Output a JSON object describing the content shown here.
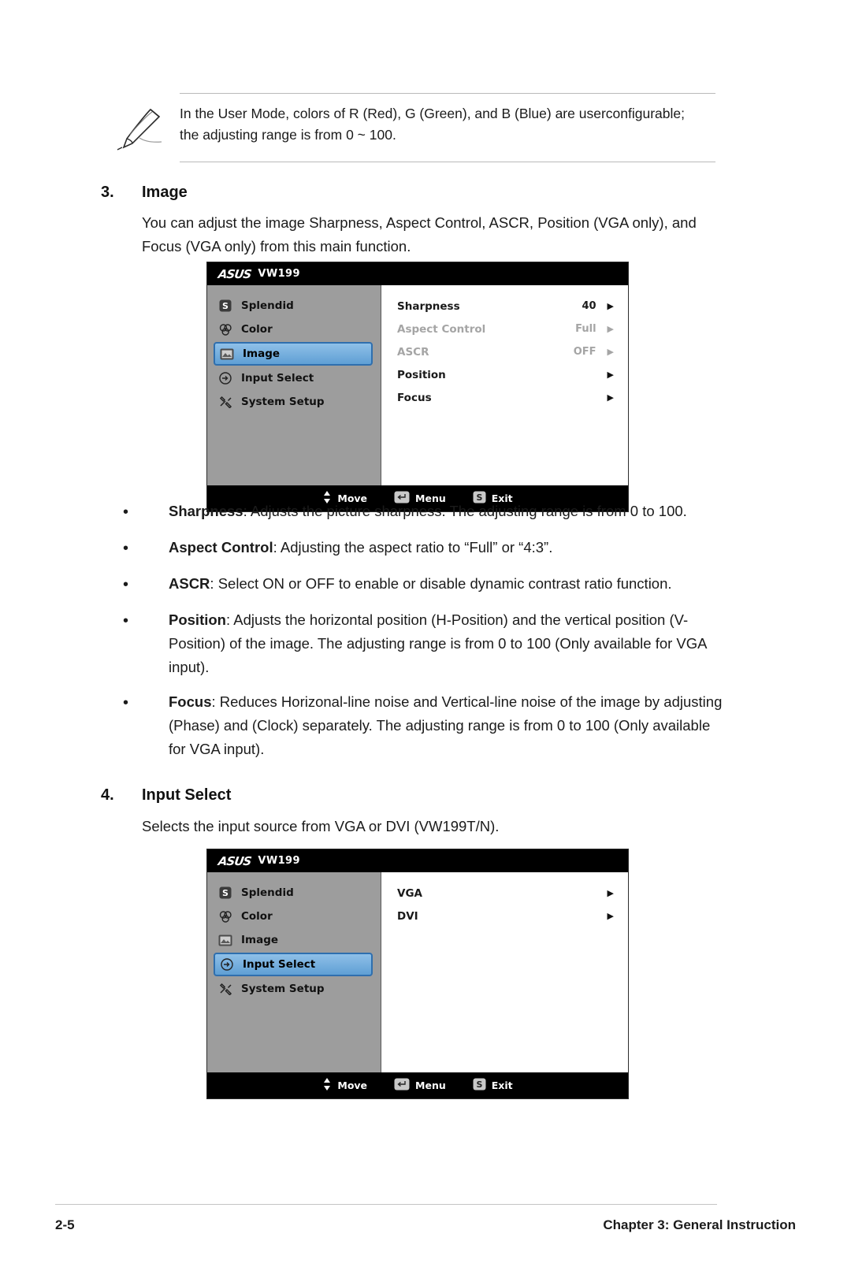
{
  "note": {
    "icon": "pencil-note-icon",
    "text": "In the User Mode, colors of R (Red), G (Green), and B (Blue) are userconfigurable; the adjusting range is from 0 ~ 100."
  },
  "section_image": {
    "number": "3.",
    "title": "Image",
    "intro": "You can adjust the image Sharpness, Aspect Control, ASCR, Position (VGA only), and Focus (VGA only) from this main function."
  },
  "osd_image": {
    "brand": "ASUS",
    "model": "VW199",
    "menu": [
      {
        "label": "Splendid",
        "icon": "splendid-icon",
        "selected": false
      },
      {
        "label": "Color",
        "icon": "color-icon",
        "selected": false
      },
      {
        "label": "Image",
        "icon": "image-icon",
        "selected": true
      },
      {
        "label": "Input Select",
        "icon": "input-select-icon",
        "selected": false
      },
      {
        "label": "System Setup",
        "icon": "system-setup-icon",
        "selected": false
      }
    ],
    "options": [
      {
        "label": "Sharpness",
        "value": "40",
        "arrow": "▶",
        "disabled": false
      },
      {
        "label": "Aspect Control",
        "value": "Full",
        "arrow": "▶",
        "disabled": true
      },
      {
        "label": "ASCR",
        "value": "OFF",
        "arrow": "▶",
        "disabled": true
      },
      {
        "label": "Position",
        "value": "",
        "arrow": "▶",
        "disabled": false
      },
      {
        "label": "Focus",
        "value": "",
        "arrow": "▶",
        "disabled": false
      }
    ],
    "footer": [
      {
        "label": "Move",
        "icon": "updown-arrows-icon"
      },
      {
        "label": "Menu",
        "icon": "menu-key-icon"
      },
      {
        "label": "Exit",
        "icon": "exit-key-icon"
      }
    ]
  },
  "bullets": [
    {
      "term": "Sharpness",
      "rest": ": Adjusts the picture sharpness. The adjusting range is from 0 to 100."
    },
    {
      "term": "Aspect Control",
      "rest": ": Adjusting the aspect ratio to “Full” or “4:3”."
    },
    {
      "term": "ASCR",
      "rest": ": Select ON or OFF to enable or disable dynamic contrast ratio function."
    },
    {
      "term": "Position",
      "rest": ": Adjusts the horizontal position (H-Position) and the vertical position (V-Position) of the image. The adjusting range is from 0 to 100 (Only available for VGA input)."
    },
    {
      "term": "Focus",
      "rest": ": Reduces Horizonal-line noise and Vertical-line noise of the image by adjusting (Phase) and (Clock) separately. The adjusting range is from 0 to 100 (Only available for VGA input)."
    }
  ],
  "section_input": {
    "number": "4.",
    "title": "Input Select",
    "intro": "Selects the input source from VGA or DVI (VW199T/N)."
  },
  "osd_input": {
    "brand": "ASUS",
    "model": "VW199",
    "menu": [
      {
        "label": "Splendid",
        "icon": "splendid-icon",
        "selected": false
      },
      {
        "label": "Color",
        "icon": "color-icon",
        "selected": false
      },
      {
        "label": "Image",
        "icon": "image-icon",
        "selected": false
      },
      {
        "label": "Input Select",
        "icon": "input-select-icon",
        "selected": true
      },
      {
        "label": "System Setup",
        "icon": "system-setup-icon",
        "selected": false
      }
    ],
    "options": [
      {
        "label": "VGA",
        "value": "",
        "arrow": "▶",
        "disabled": false
      },
      {
        "label": "DVI",
        "value": "",
        "arrow": "▶",
        "disabled": false
      }
    ],
    "footer": [
      {
        "label": "Move",
        "icon": "updown-arrows-icon"
      },
      {
        "label": "Menu",
        "icon": "menu-key-icon"
      },
      {
        "label": "Exit",
        "icon": "exit-key-icon"
      }
    ]
  },
  "footer": {
    "page_number": "2-5",
    "chapter": "Chapter 3: General Instruction"
  }
}
